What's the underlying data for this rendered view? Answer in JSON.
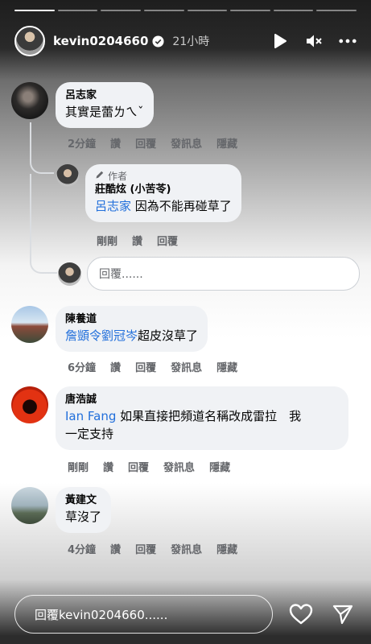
{
  "story": {
    "segments": 8,
    "active_segments": 1,
    "username": "kevin0204660",
    "time_ago": "21小時"
  },
  "comments": [
    {
      "author": "呂志家",
      "text": "其實是蕾ㄌㄟˇ",
      "time": "2分鐘",
      "actions": [
        "讚",
        "回覆",
        "發訊息",
        "隱藏"
      ]
    },
    {
      "author_tag": "作者",
      "author": "莊酷炫 (小苦苓)",
      "mention": "呂志家",
      "text": " 因為不能再碰草了",
      "time": "剛剛",
      "actions": [
        "讚",
        "回覆"
      ]
    },
    {
      "author": "陳養道",
      "mention": "詹顗令劉冠岑",
      "text": "超皮沒草了",
      "time": "6分鐘",
      "actions": [
        "讚",
        "回覆",
        "發訊息",
        "隱藏"
      ]
    },
    {
      "author": "唐浩誠",
      "mention": "Ian Fang",
      "text_line1": " 如果直接把頻道名稱改成雷拉　我",
      "text_line2": "一定支持",
      "time": "剛剛",
      "actions": [
        "讚",
        "回覆",
        "發訊息",
        "隱藏"
      ]
    },
    {
      "author": "黃建文",
      "text": "草沒了",
      "time": "4分鐘",
      "actions": [
        "讚",
        "回覆",
        "發訊息",
        "隱藏"
      ]
    }
  ],
  "reply_input": {
    "placeholder": "回覆......"
  },
  "bottom": {
    "message_placeholder": "回覆kevin0204660......"
  },
  "colors": {
    "mention": "#216fdb",
    "bubble": "#f0f2f5",
    "meta": "#65676b"
  },
  "icons": [
    "verified-badge-icon",
    "play-icon",
    "mute-icon",
    "more-options-icon",
    "pencil-icon",
    "heart-icon",
    "send-icon"
  ]
}
